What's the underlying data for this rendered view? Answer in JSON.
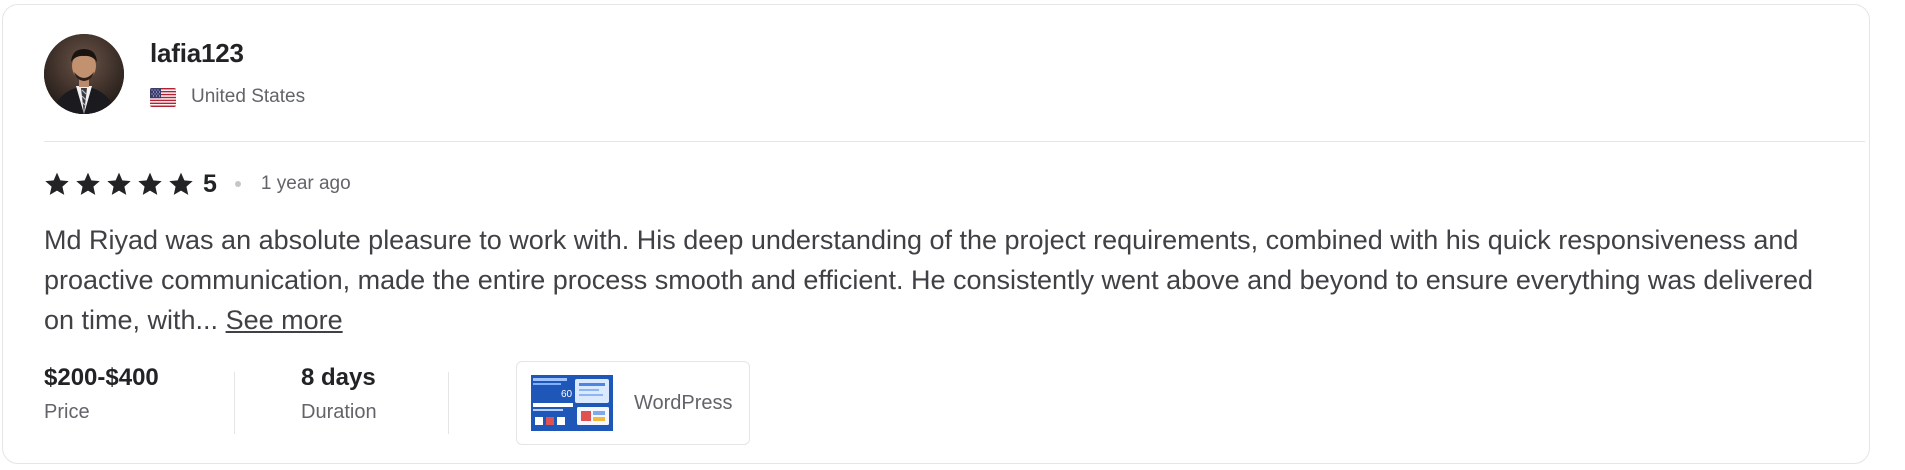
{
  "reviewer": {
    "username": "lafia123",
    "country": "United States",
    "flag_icon": "us-flag-icon"
  },
  "rating": {
    "stars": 5,
    "value_label": "5",
    "time_ago": "1 year ago"
  },
  "review": {
    "text": "Md Riyad was an absolute pleasure to work with. His deep understanding of the project requirements, combined with his quick responsiveness and proactive communication, made the entire process smooth and efficient. He consistently went above and beyond to ensure everything was delivered on time, with...",
    "see_more_label": "See more"
  },
  "meta": {
    "price_value": "$200-$400",
    "price_label": "Price",
    "duration_value": "8 days",
    "duration_label": "Duration"
  },
  "gig": {
    "category": "WordPress",
    "thumb_number": "60"
  },
  "colors": {
    "star": "#222325",
    "text_primary": "#222325",
    "text_secondary": "#62646a",
    "border": "#e4e5e7"
  }
}
